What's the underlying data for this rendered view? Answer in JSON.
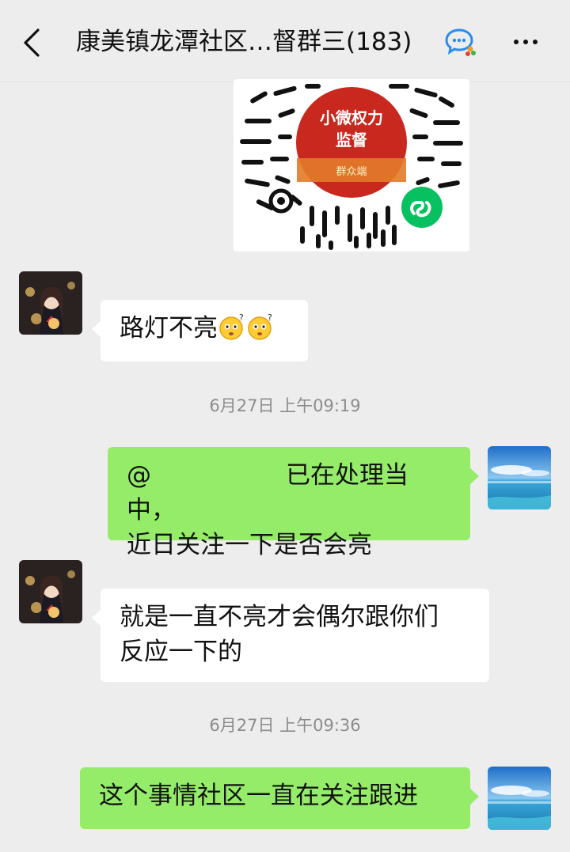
{
  "header": {
    "title": "康美镇龙潭社区…督群三(183)"
  },
  "qr_card": {
    "center_line1": "小微权力",
    "center_line2": "监督",
    "center_banner": "群众端"
  },
  "messages": [
    {
      "side": "left",
      "text": "路灯不亮"
    },
    {
      "timestamp": "6月27日 上午09:19"
    },
    {
      "side": "right",
      "mention": "@",
      "text_line1": "已在处理当中，",
      "text_line2": "近日关注一下是否会亮"
    },
    {
      "side": "left",
      "text_line1": "就是一直不亮才会偶尔跟你们",
      "text_line2": "反应一下的"
    },
    {
      "timestamp": "6月27日 上午09:36"
    },
    {
      "side": "right",
      "text": "这个事情社区一直在关注跟进"
    }
  ],
  "colors": {
    "background": "#ededed",
    "bubble_self": "#95ec69",
    "bubble_other": "#ffffff",
    "timestamp": "#8c8c8c",
    "qr_center": "#c8281e"
  },
  "icons": {
    "back": "chevron-left-icon",
    "group": "group-chat-icon",
    "more": "more-dots-icon",
    "emoji": "confused-face-emoji-icon",
    "mini_program": "mini-program-icon"
  }
}
